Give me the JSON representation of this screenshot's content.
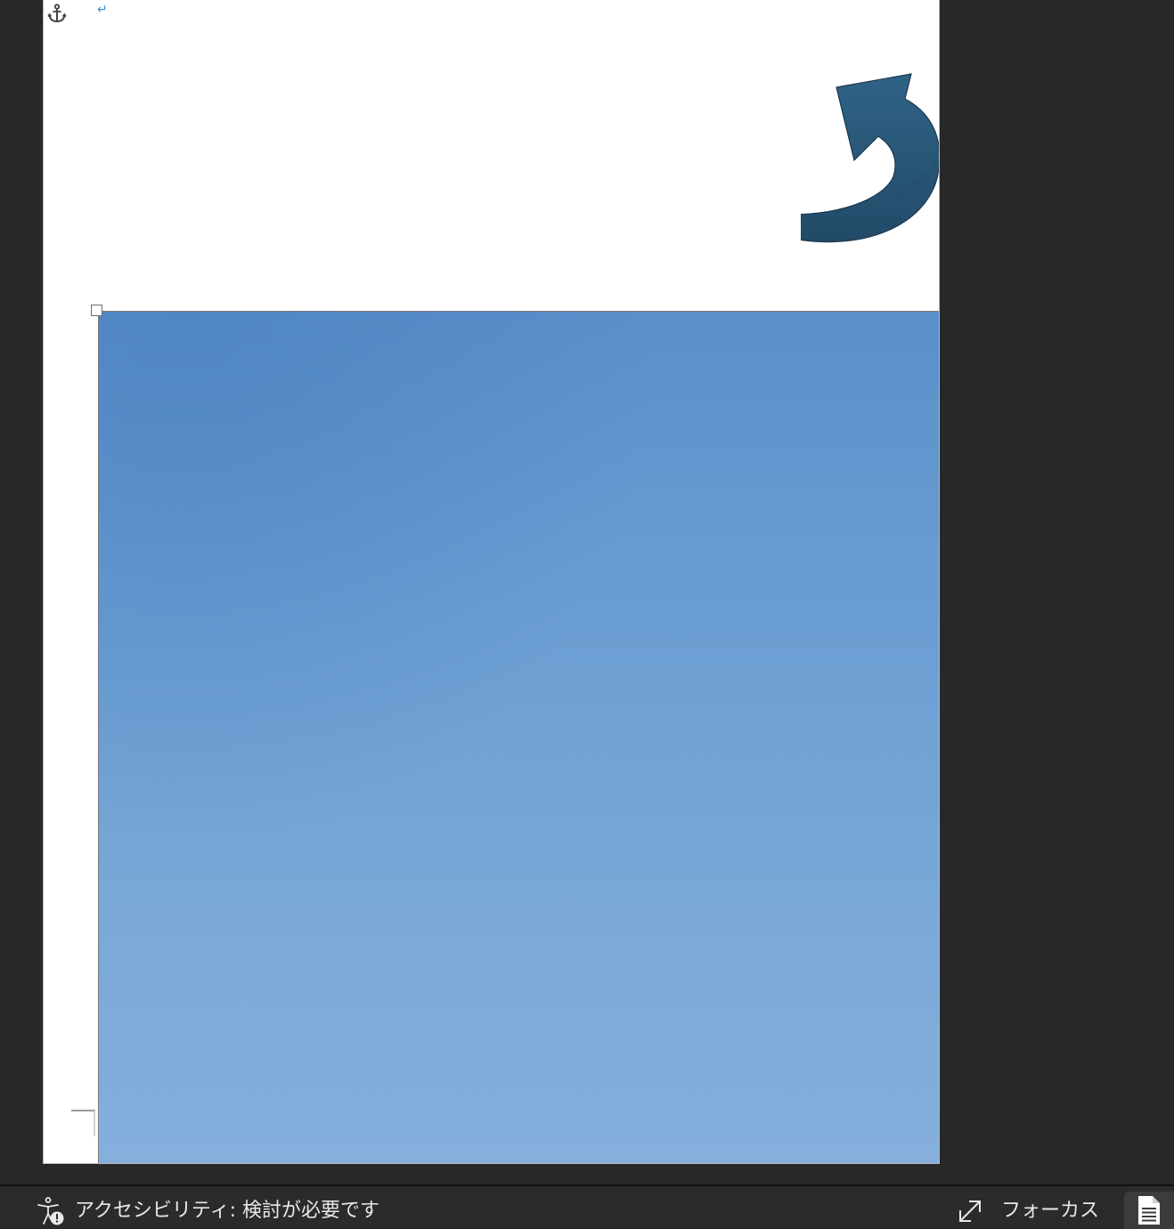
{
  "document": {
    "paragraph_mark": "↵",
    "shape": "curved-arrow",
    "image": "sky-image"
  },
  "statusbar": {
    "accessibility_label": "アクセシビリティ: 検討が必要です",
    "focus_label": "フォーカス",
    "view_icon": "print-layout-icon"
  },
  "colors": {
    "workspace": "#282828",
    "page": "#ffffff",
    "arrow_fill": "#2c5b7c",
    "sky_top": "#5a8fca",
    "sky_bottom": "#86afdc",
    "statusbar": "#2b2b2b",
    "status_text": "#e8e8e8"
  }
}
